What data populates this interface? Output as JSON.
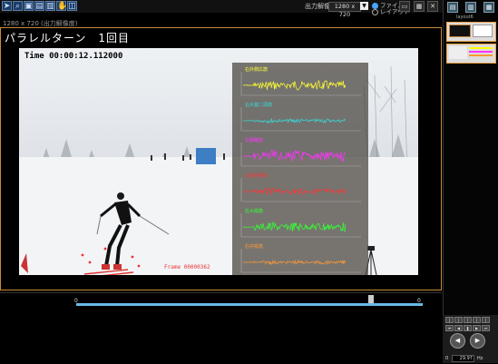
{
  "toolbar": {
    "icons": [
      "cursor-icon",
      "search-icon",
      "image-icon",
      "image-icon",
      "image-icon",
      "hand-icon",
      "frame-icon"
    ],
    "resolution_label": "出力解像度",
    "resolution_value": "1280 x 720",
    "radio_file": "ファイル",
    "radio_layout": "レイアウト"
  },
  "subtitle": "1280 x 720 (出力解像度)",
  "title": "パラレルターン　1回目",
  "video": {
    "time": "Time  00:00:12.112000",
    "frame": "Frame  00000362"
  },
  "sensors": [
    {
      "label": "右外側広筋",
      "color": "#ffff33",
      "amp": 0.8
    },
    {
      "label": "右大腿二頭筋",
      "color": "#33dddd",
      "amp": 0.35
    },
    {
      "label": "右腓腹筋",
      "color": "#ff33ff",
      "amp": 1.0
    },
    {
      "label": "右前脛骨筋",
      "color": "#ff3333",
      "amp": 0.55
    },
    {
      "label": "右大殿筋",
      "color": "#33ff33",
      "amp": 0.8
    },
    {
      "label": "右中殿筋",
      "color": "#ff9933",
      "amp": 0.3
    }
  ],
  "timeline": {
    "start": "0",
    "end": "0",
    "position": 0.85
  },
  "right_panel": {
    "tab_label": "layout6"
  },
  "controls": {
    "speed_start": "0",
    "speed_value": "29.97",
    "speed_unit": "Hz"
  }
}
